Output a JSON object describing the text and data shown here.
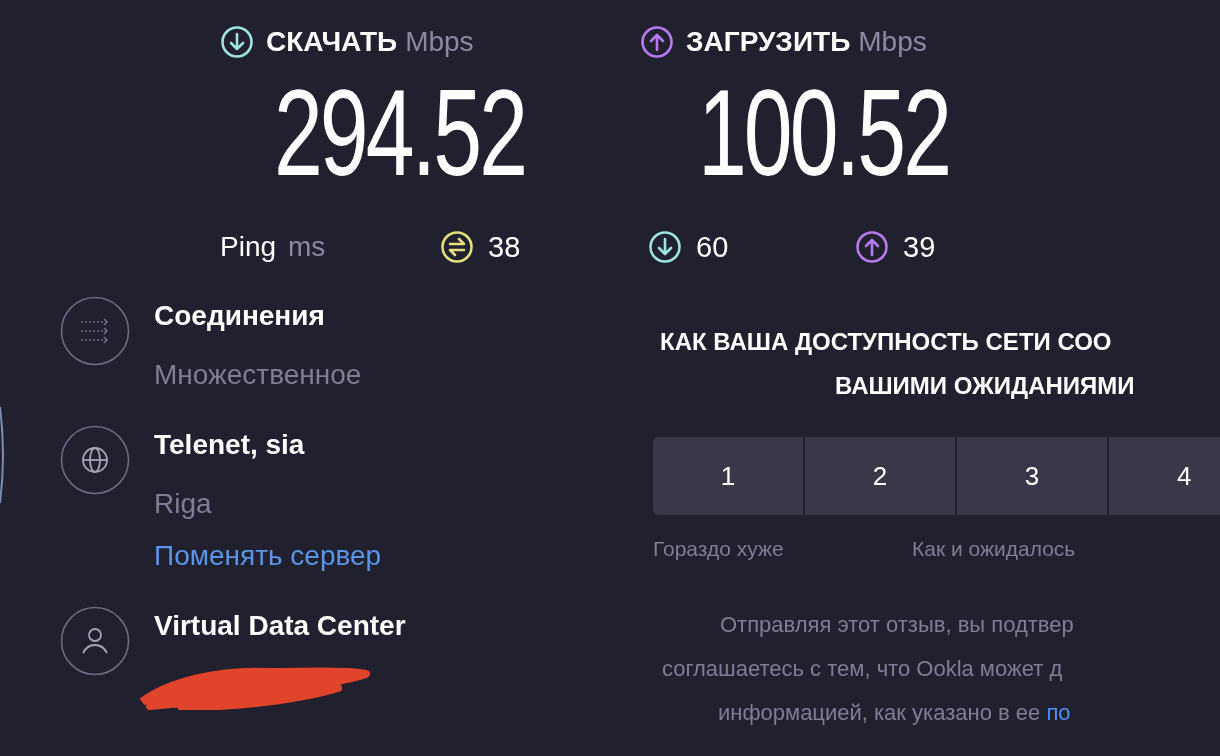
{
  "download": {
    "label": "СКАЧАТЬ",
    "unit": "Mbps",
    "value": "294.52"
  },
  "upload": {
    "label": "ЗАГРУЗИТЬ",
    "unit": "Mbps",
    "value": "100.52"
  },
  "ping": {
    "label": "Ping",
    "unit": "ms",
    "idle": "38",
    "download": "60",
    "upload": "39"
  },
  "server_info": [
    {
      "kind": "connections",
      "title": "Соединения",
      "subtitle": "Множественное"
    },
    {
      "kind": "server",
      "title": "Telenet, sia",
      "subtitle": "Riga",
      "link": "Поменять сервер"
    },
    {
      "kind": "host",
      "title": "Virtual Data Center",
      "redacted": true
    }
  ],
  "survey": {
    "question_lines": [
      "КАК ВАША ДОСТУПНОСТЬ СЕТИ СОО",
      "ВАШИМИ ОЖИДАНИЯМИ"
    ],
    "scale": [
      {
        "label": "1",
        "selected": false
      },
      {
        "label": "2",
        "selected": false
      },
      {
        "label": "3",
        "selected": false
      },
      {
        "label": "4",
        "selected": false
      }
    ],
    "scale_labels": [
      "Гораздо хуже",
      "Как и ожидалось"
    ],
    "disclaimer_lines": [
      "Отправляя этот отзыв, вы подтвер",
      "соглашаетесь с тем, что Ookla может д",
      "информацией, как указано в ее "
    ],
    "disclaimer_link": "по"
  }
}
